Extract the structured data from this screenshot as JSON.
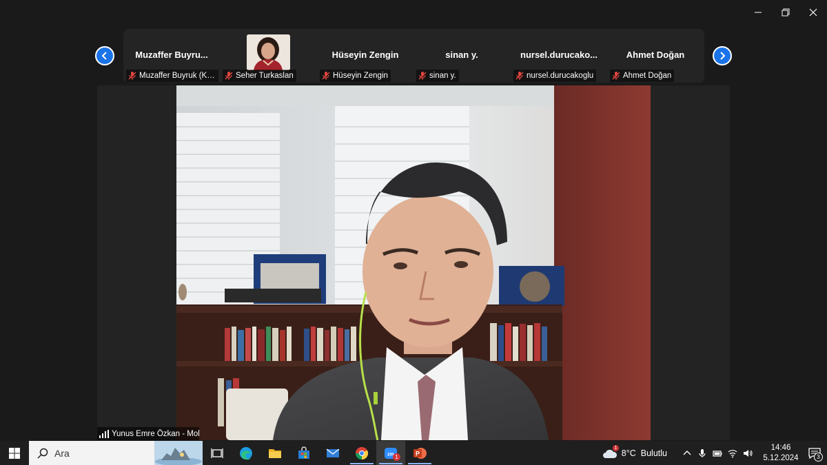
{
  "window": {
    "minimize": "minimize",
    "restore": "restore",
    "close": "close"
  },
  "strip": {
    "participants": [
      {
        "name": "Muzaffer  Buyru...",
        "label": "Muzaffer Buyruk (K.K...."
      },
      {
        "name": "",
        "label": "Seher Turkaslan"
      },
      {
        "name": "Hüseyin Zengin",
        "label": "Hüseyin Zengin"
      },
      {
        "name": "sinan y.",
        "label": "sinan y."
      },
      {
        "name": "nursel.durucako...",
        "label": "nursel.durucakoglu"
      },
      {
        "name": "Ahmet Doğan",
        "label": "Ahmet Doğan"
      }
    ]
  },
  "main_video": {
    "speaker_label": "Yunus Emre Özkan - Mol"
  },
  "taskbar": {
    "search_text": "Ara",
    "apps": [
      "task-view",
      "edge",
      "file-explorer",
      "microsoft-store",
      "mail",
      "chrome",
      "zoom",
      "powerpoint"
    ],
    "zoom_badge": "1",
    "weather": {
      "badge": "1",
      "temp": "8°C",
      "condition": "Bulutlu"
    },
    "clock": {
      "time": "14:46",
      "date": "5.12.2024"
    },
    "notification_count": "3"
  },
  "colors": {
    "accent": "#1a73e8",
    "mic_off": "#e0463e",
    "taskbar": "#1f1f1f"
  }
}
